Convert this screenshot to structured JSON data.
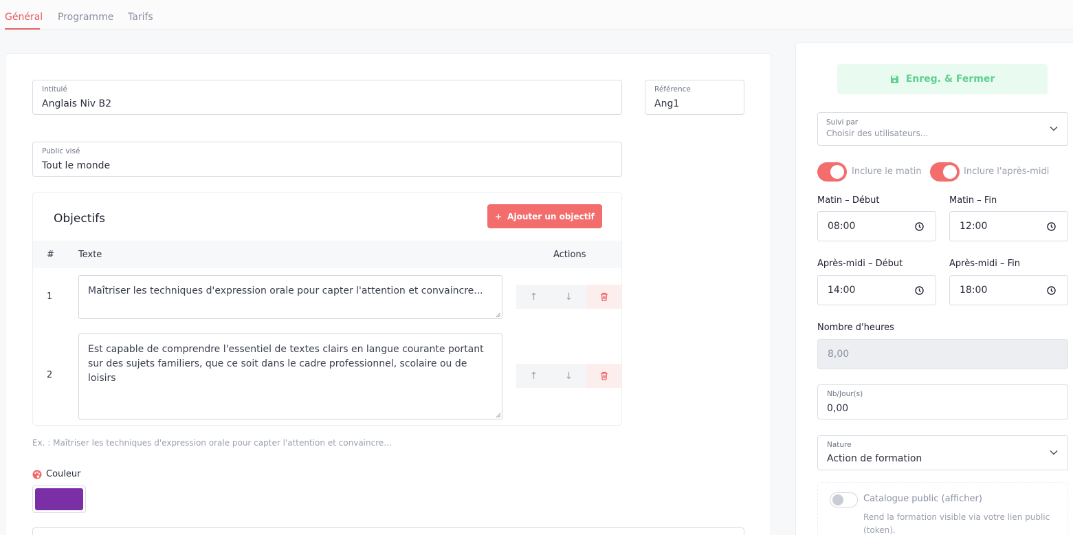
{
  "tabs": [
    {
      "label": "Général"
    },
    {
      "label": "Programme"
    },
    {
      "label": "Tarifs"
    }
  ],
  "form": {
    "intitule": {
      "label": "Intitulé",
      "value": "Anglais Niv B2"
    },
    "reference": {
      "label": "Référence",
      "value": "Ang1"
    },
    "public": {
      "label": "Public visé",
      "value": "Tout le monde"
    }
  },
  "objectives": {
    "title": "Objectifs",
    "add_label": "Ajouter un objectif",
    "columns": {
      "num": "#",
      "text": "Texte",
      "actions": "Actions"
    },
    "rows": [
      {
        "num": "1",
        "text": "Maîtriser les techniques d'expression orale pour capter l'attention et convaincre..."
      },
      {
        "num": "2",
        "text": "Est capable de comprendre l'essentiel de textes clairs en langue courante portant sur des sujets familiers, que ce soit dans le cadre professionnel, scolaire ou de loisirs"
      }
    ],
    "hint": "Ex. : Maîtriser les techniques d'expression orale pour capter l'attention et convaincre..."
  },
  "color": {
    "label": "Couleur",
    "value": "#7b2fa6"
  },
  "sidebar": {
    "save_label": "Enreg. & Fermer",
    "suivi": {
      "label": "Suivi par",
      "placeholder": "Choisir des utilisateurs..."
    },
    "toggle_matin": {
      "label": "Inclure le matin",
      "on": true
    },
    "toggle_aprem": {
      "label": "Inclure l'après-midi",
      "on": true
    },
    "matin_debut": {
      "label": "Matin – Début",
      "value": "08:00"
    },
    "matin_fin": {
      "label": "Matin – Fin",
      "value": "12:00"
    },
    "aprem_debut": {
      "label": "Après-midi – Début",
      "value": "14:00"
    },
    "aprem_fin": {
      "label": "Après-midi – Fin",
      "value": "18:00"
    },
    "heures": {
      "label": "Nombre d'heures",
      "value": "8,00"
    },
    "nbjours": {
      "label": "Nb/Jour(s)",
      "value": "0,00"
    },
    "nature": {
      "label": "Nature",
      "value": "Action de formation"
    },
    "catalogue": {
      "title": "Catalogue public (afficher)",
      "desc": "Rend la formation visible via votre lien public (token).",
      "on": false
    }
  },
  "colors": {
    "accent": "#f36d6d",
    "success": "#5fd08f",
    "swatch": "#7b2fa6"
  }
}
